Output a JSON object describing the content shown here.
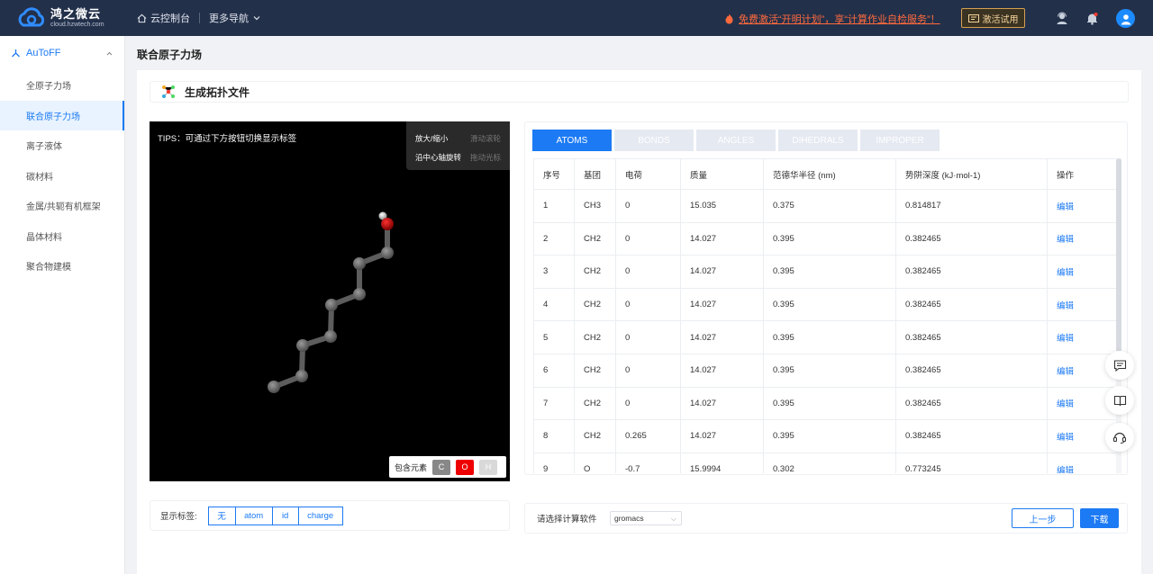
{
  "brand": {
    "name": "鸿之微云",
    "domain": "cloud.hzwtech.com"
  },
  "header": {
    "console": "云控制台",
    "more_nav": "更多导航",
    "promo": "免费激活“开明计划”，享“计算作业自检服务”！",
    "trial_button": "激活试用"
  },
  "sidebar": {
    "group": "AuToFF",
    "items": [
      {
        "label": "全原子力场"
      },
      {
        "label": "联合原子力场"
      },
      {
        "label": "离子液体"
      },
      {
        "label": "碳材料"
      },
      {
        "label": "金属/共轭有机框架"
      },
      {
        "label": "晶体材料"
      },
      {
        "label": "聚合物建模"
      }
    ],
    "active_index": 1
  },
  "page": {
    "title": "联合原子力场",
    "section_title": "生成拓扑文件"
  },
  "viewer": {
    "tips": "TIPS：可通过下方按钮切换显示标签",
    "hints": [
      {
        "key": "放大/缩小",
        "value": "滑动滚轮"
      },
      {
        "key": "沿中心轴旋转",
        "value": "拖动光标"
      }
    ],
    "elements_label": "包含元素",
    "elements": [
      "C",
      "O",
      "H"
    ],
    "element_colors": {
      "C": "#888888",
      "O": "#ee0000",
      "H": "#d9d9d9"
    }
  },
  "tabs": [
    "ATOMS",
    "BONDS",
    "ANGLES",
    "DIHEDRALS",
    "IMPROPER"
  ],
  "table": {
    "headers": [
      "序号",
      "基团",
      "电荷",
      "质量",
      "范德华半径 (nm)",
      "势阱深度 (kJ·mol-1)",
      "操作"
    ],
    "rows": [
      [
        "1",
        "CH3",
        "0",
        "15.035",
        "0.375",
        "0.814817",
        "编辑"
      ],
      [
        "2",
        "CH2",
        "0",
        "14.027",
        "0.395",
        "0.382465",
        "编辑"
      ],
      [
        "3",
        "CH2",
        "0",
        "14.027",
        "0.395",
        "0.382465",
        "编辑"
      ],
      [
        "4",
        "CH2",
        "0",
        "14.027",
        "0.395",
        "0.382465",
        "编辑"
      ],
      [
        "5",
        "CH2",
        "0",
        "14.027",
        "0.395",
        "0.382465",
        "编辑"
      ],
      [
        "6",
        "CH2",
        "0",
        "14.027",
        "0.395",
        "0.382465",
        "编辑"
      ],
      [
        "7",
        "CH2",
        "0",
        "14.027",
        "0.395",
        "0.382465",
        "编辑"
      ],
      [
        "8",
        "CH2",
        "0.265",
        "14.027",
        "0.395",
        "0.382465",
        "编辑"
      ],
      [
        "9",
        "O",
        "-0.7",
        "15.9994",
        "0.302",
        "0.773245",
        "编辑"
      ]
    ]
  },
  "label_bar": {
    "label": "显示标签:",
    "options": [
      "无",
      "atom",
      "id",
      "charge"
    ]
  },
  "software": {
    "label": "请选择计算软件",
    "selected": "gromacs"
  },
  "actions": {
    "prev": "上一步",
    "download": "下载"
  },
  "colors": {
    "accent": "#1c7af4",
    "header_bg": "#23304a",
    "promo": "#ff6a3d"
  }
}
